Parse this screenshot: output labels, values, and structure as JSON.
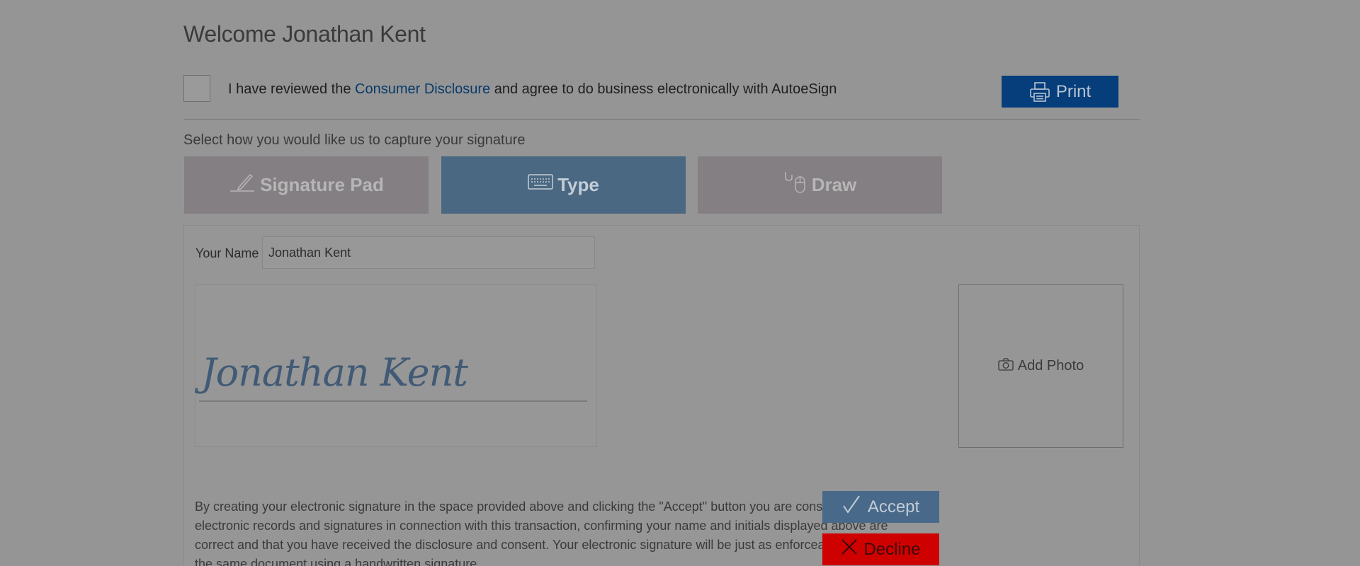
{
  "welcome": {
    "title": "Welcome Jonathan Kent"
  },
  "consent": {
    "text_before": "I have reviewed the ",
    "link_text": "Consumer Disclosure",
    "text_after": " and agree to do business electronically with AutoeSign",
    "checked": false
  },
  "print_button": {
    "label": "Print",
    "icon": "printer-icon"
  },
  "capture": {
    "prompt": "Select how you would like us to capture your signature",
    "tabs": [
      {
        "label": "Signature Pad",
        "icon": "pen-icon",
        "selected": false
      },
      {
        "label": "Type",
        "icon": "keyboard-icon",
        "selected": true
      },
      {
        "label": "Draw",
        "icon": "mouse-icon",
        "selected": false
      }
    ]
  },
  "form": {
    "name_label": "Your Name",
    "name_value": "Jonathan Kent",
    "signature_preview": "Jonathan Kent",
    "add_photo_label": "Add Photo",
    "add_photo_icon": "camera-icon"
  },
  "legal": {
    "text": "By creating your electronic signature in the space provided above and clicking the \"Accept\" button you are consenting to use electronic records and signatures in connection with this transaction, confirming your name and initials displayed above are correct and that you have received the disclosure and consent. Your electronic signature will be just as enforceable as signing the same document using a handwritten signature."
  },
  "actions": {
    "accept_label": "Accept",
    "accept_icon": "checkmark-icon",
    "decline_label": "Decline",
    "decline_icon": "x-icon"
  },
  "colors": {
    "overlay_background": "#959595",
    "print_button": "#053e7a",
    "selected_tab": "#4a6882",
    "unselected_tab": "#847f83",
    "accept_button": "#48698a",
    "decline_button": "#cf0000",
    "link": "#0a3a6a",
    "signature_ink": "#415a75"
  }
}
